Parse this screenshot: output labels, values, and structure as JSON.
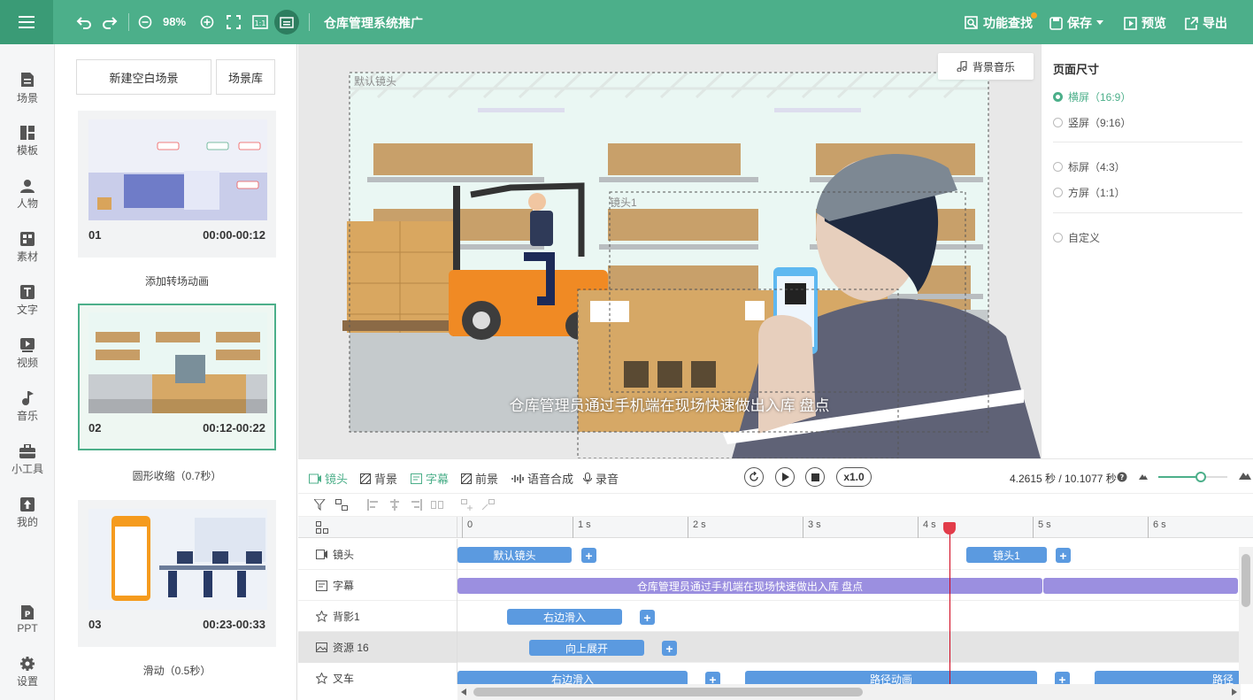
{
  "topbar": {
    "zoom": "98%",
    "title": "仓库管理系统推广",
    "find_label": "功能查找",
    "save_label": "保存",
    "preview_label": "预览",
    "export_label": "导出"
  },
  "nav": [
    "场景",
    "模板",
    "人物",
    "素材",
    "文字",
    "视频",
    "音乐",
    "小工具",
    "我的",
    "PPT",
    "设置"
  ],
  "scenes_panel": {
    "new_blank": "新建空白场景",
    "library": "场景库",
    "items": [
      {
        "num": "01",
        "time": "00:00-00:12",
        "transition": "添加转场动画"
      },
      {
        "num": "02",
        "time": "00:12-00:22",
        "transition": "圆形收缩（0.7秒）"
      },
      {
        "num": "03",
        "time": "00:23-00:33",
        "transition": "滑动（0.5秒）"
      }
    ]
  },
  "canvas": {
    "bgm_label": "背景音乐",
    "default_camera": "默认镜头",
    "camera1": "镜头1",
    "subtitle": "仓库管理员通过手机端在现场快速做出入库  盘点"
  },
  "page_size": {
    "title": "页面尺寸",
    "options": [
      "横屏（16:9）",
      "竖屏（9:16）",
      "标屏（4:3）",
      "方屏（1:1）",
      "自定义"
    ],
    "selected": "横屏（16:9）"
  },
  "timeline": {
    "tabs": [
      "镜头",
      "背景",
      "字幕",
      "前景",
      "语音合成",
      "录音"
    ],
    "speed": "x1.0",
    "time_readout": "4.2615 秒 / 10.1077 秒",
    "zoom_fraction": 0.62,
    "playhead_seconds": 4.2615,
    "ruler": [
      "0",
      "1 s",
      "2 s",
      "3 s",
      "4 s",
      "5 s",
      "6 s"
    ],
    "tracks": [
      {
        "name": "镜头",
        "icon": "camera-icon",
        "clips": [
          "默认镜头",
          "镜头1"
        ]
      },
      {
        "name": "字幕",
        "icon": "subtitle-icon",
        "clips": [
          "仓库管理员通过手机端在现场快速做出入库  盘点",
          ""
        ]
      },
      {
        "name": "背影1",
        "icon": "star-icon",
        "clips": [
          "右边滑入"
        ]
      },
      {
        "name": "资源 16",
        "icon": "image-icon",
        "clips": [
          "向上展开"
        ]
      },
      {
        "name": "叉车",
        "icon": "star-icon",
        "clips": [
          "右边滑入",
          "路径动画",
          "路径"
        ]
      }
    ]
  },
  "colors": {
    "accent": "#4caf8a",
    "clip_blue": "#5b9ae0",
    "clip_purple": "#9b8fe0",
    "playhead": "#d0021b"
  }
}
